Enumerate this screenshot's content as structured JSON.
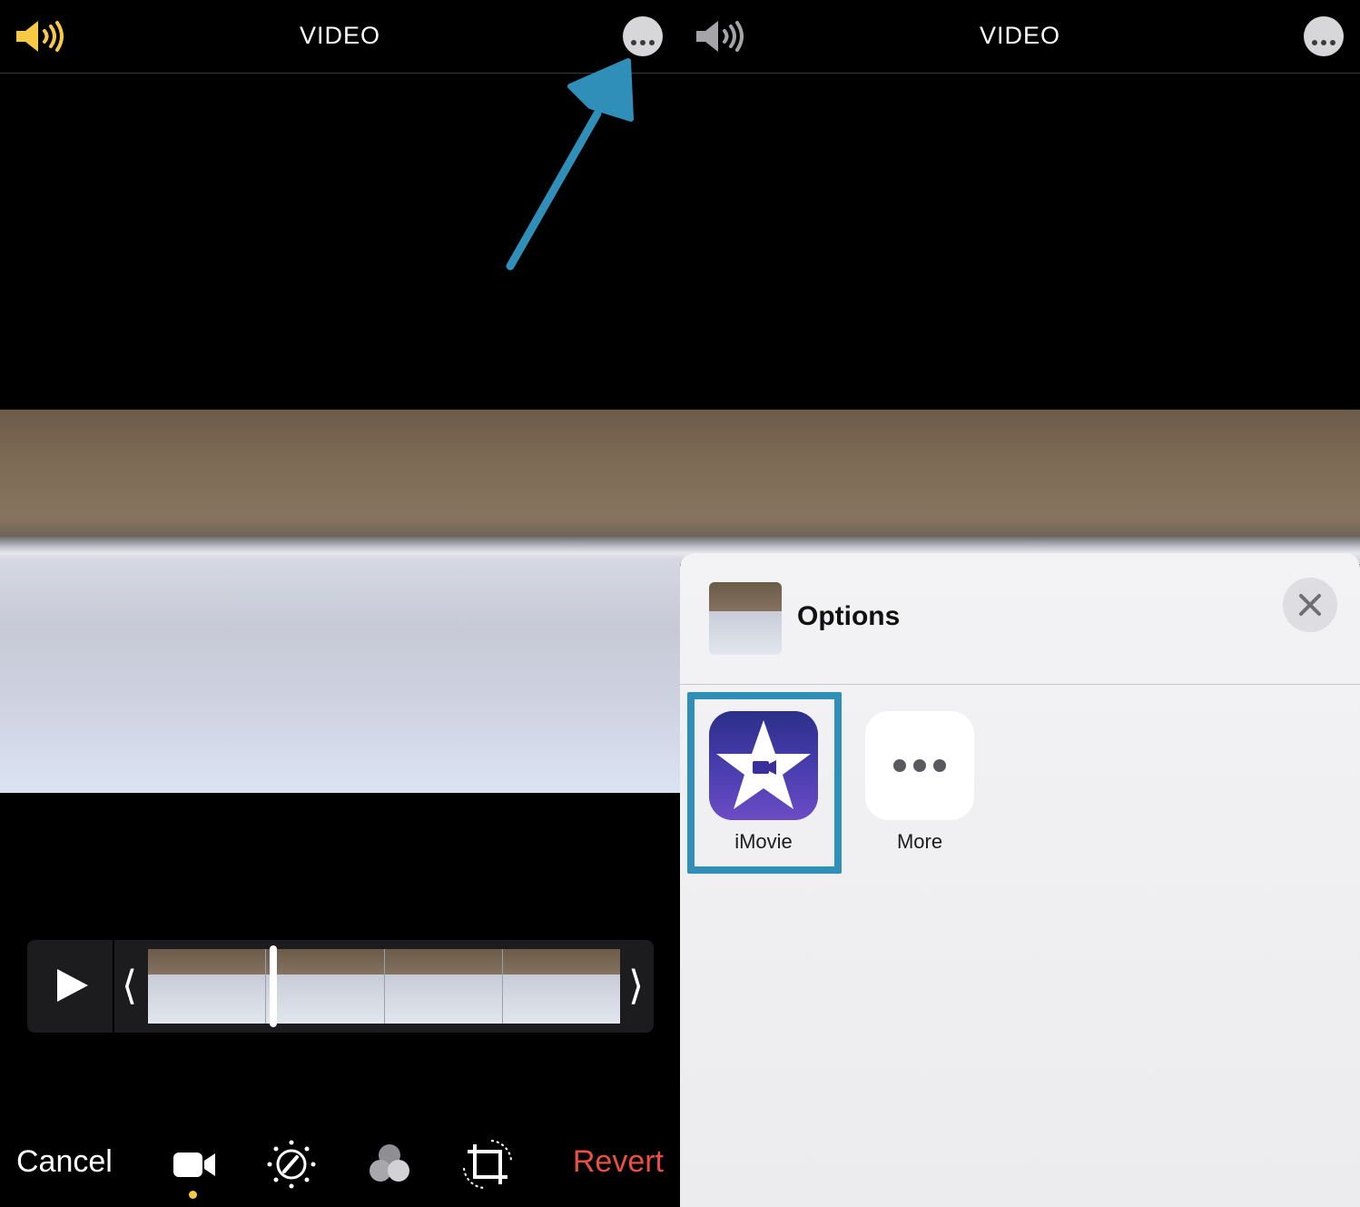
{
  "left": {
    "header": {
      "title": "VIDEO"
    },
    "toolbar": {
      "cancel_label": "Cancel",
      "revert_label": "Revert"
    }
  },
  "right": {
    "header": {
      "title": "VIDEO"
    },
    "sheet": {
      "title": "Options",
      "apps": [
        {
          "label": "iMovie"
        },
        {
          "label": "More"
        }
      ]
    }
  },
  "colors": {
    "speaker_active": "#f7c945",
    "revert_red": "#eb4f42",
    "annotation_blue": "#2f8fb9"
  },
  "icons": {
    "speaker": "speaker-volume-icon",
    "more": "ellipsis-circle-icon",
    "video_tool": "video-camera-icon",
    "adjust_tool": "adjust-dial-icon",
    "filters_tool": "filters-circles-icon",
    "crop_tool": "crop-rotate-icon",
    "close": "close-icon"
  }
}
